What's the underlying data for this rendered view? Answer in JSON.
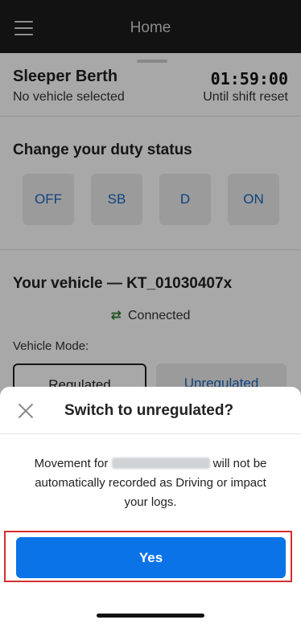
{
  "header": {
    "title": "Home",
    "menu_icon": "hamburger-menu-icon"
  },
  "status": {
    "current_status": "Sleeper Berth",
    "vehicle_note": "No vehicle selected",
    "timer": "01:59:00",
    "timer_label": "Until shift reset"
  },
  "duty": {
    "heading": "Change your duty status",
    "buttons": [
      "OFF",
      "SB",
      "D",
      "ON"
    ]
  },
  "vehicle": {
    "heading": "Your vehicle — KT_01030407x",
    "connection": "Connected",
    "connection_icon": "connected-arrows-icon",
    "mode_label": "Vehicle Mode:",
    "modes": [
      "Regulated",
      "Unregulated"
    ]
  },
  "dialog": {
    "title": "Switch to unregulated?",
    "close_icon": "close-icon",
    "message_prefix": "Movement for",
    "message_suffix": "will not be automatically recorded as Driving or impact your logs.",
    "confirm_label": "Yes"
  },
  "colors": {
    "primary": "#0a73e8",
    "highlight_frame": "#d32f2f",
    "connected": "#2e7d32"
  }
}
